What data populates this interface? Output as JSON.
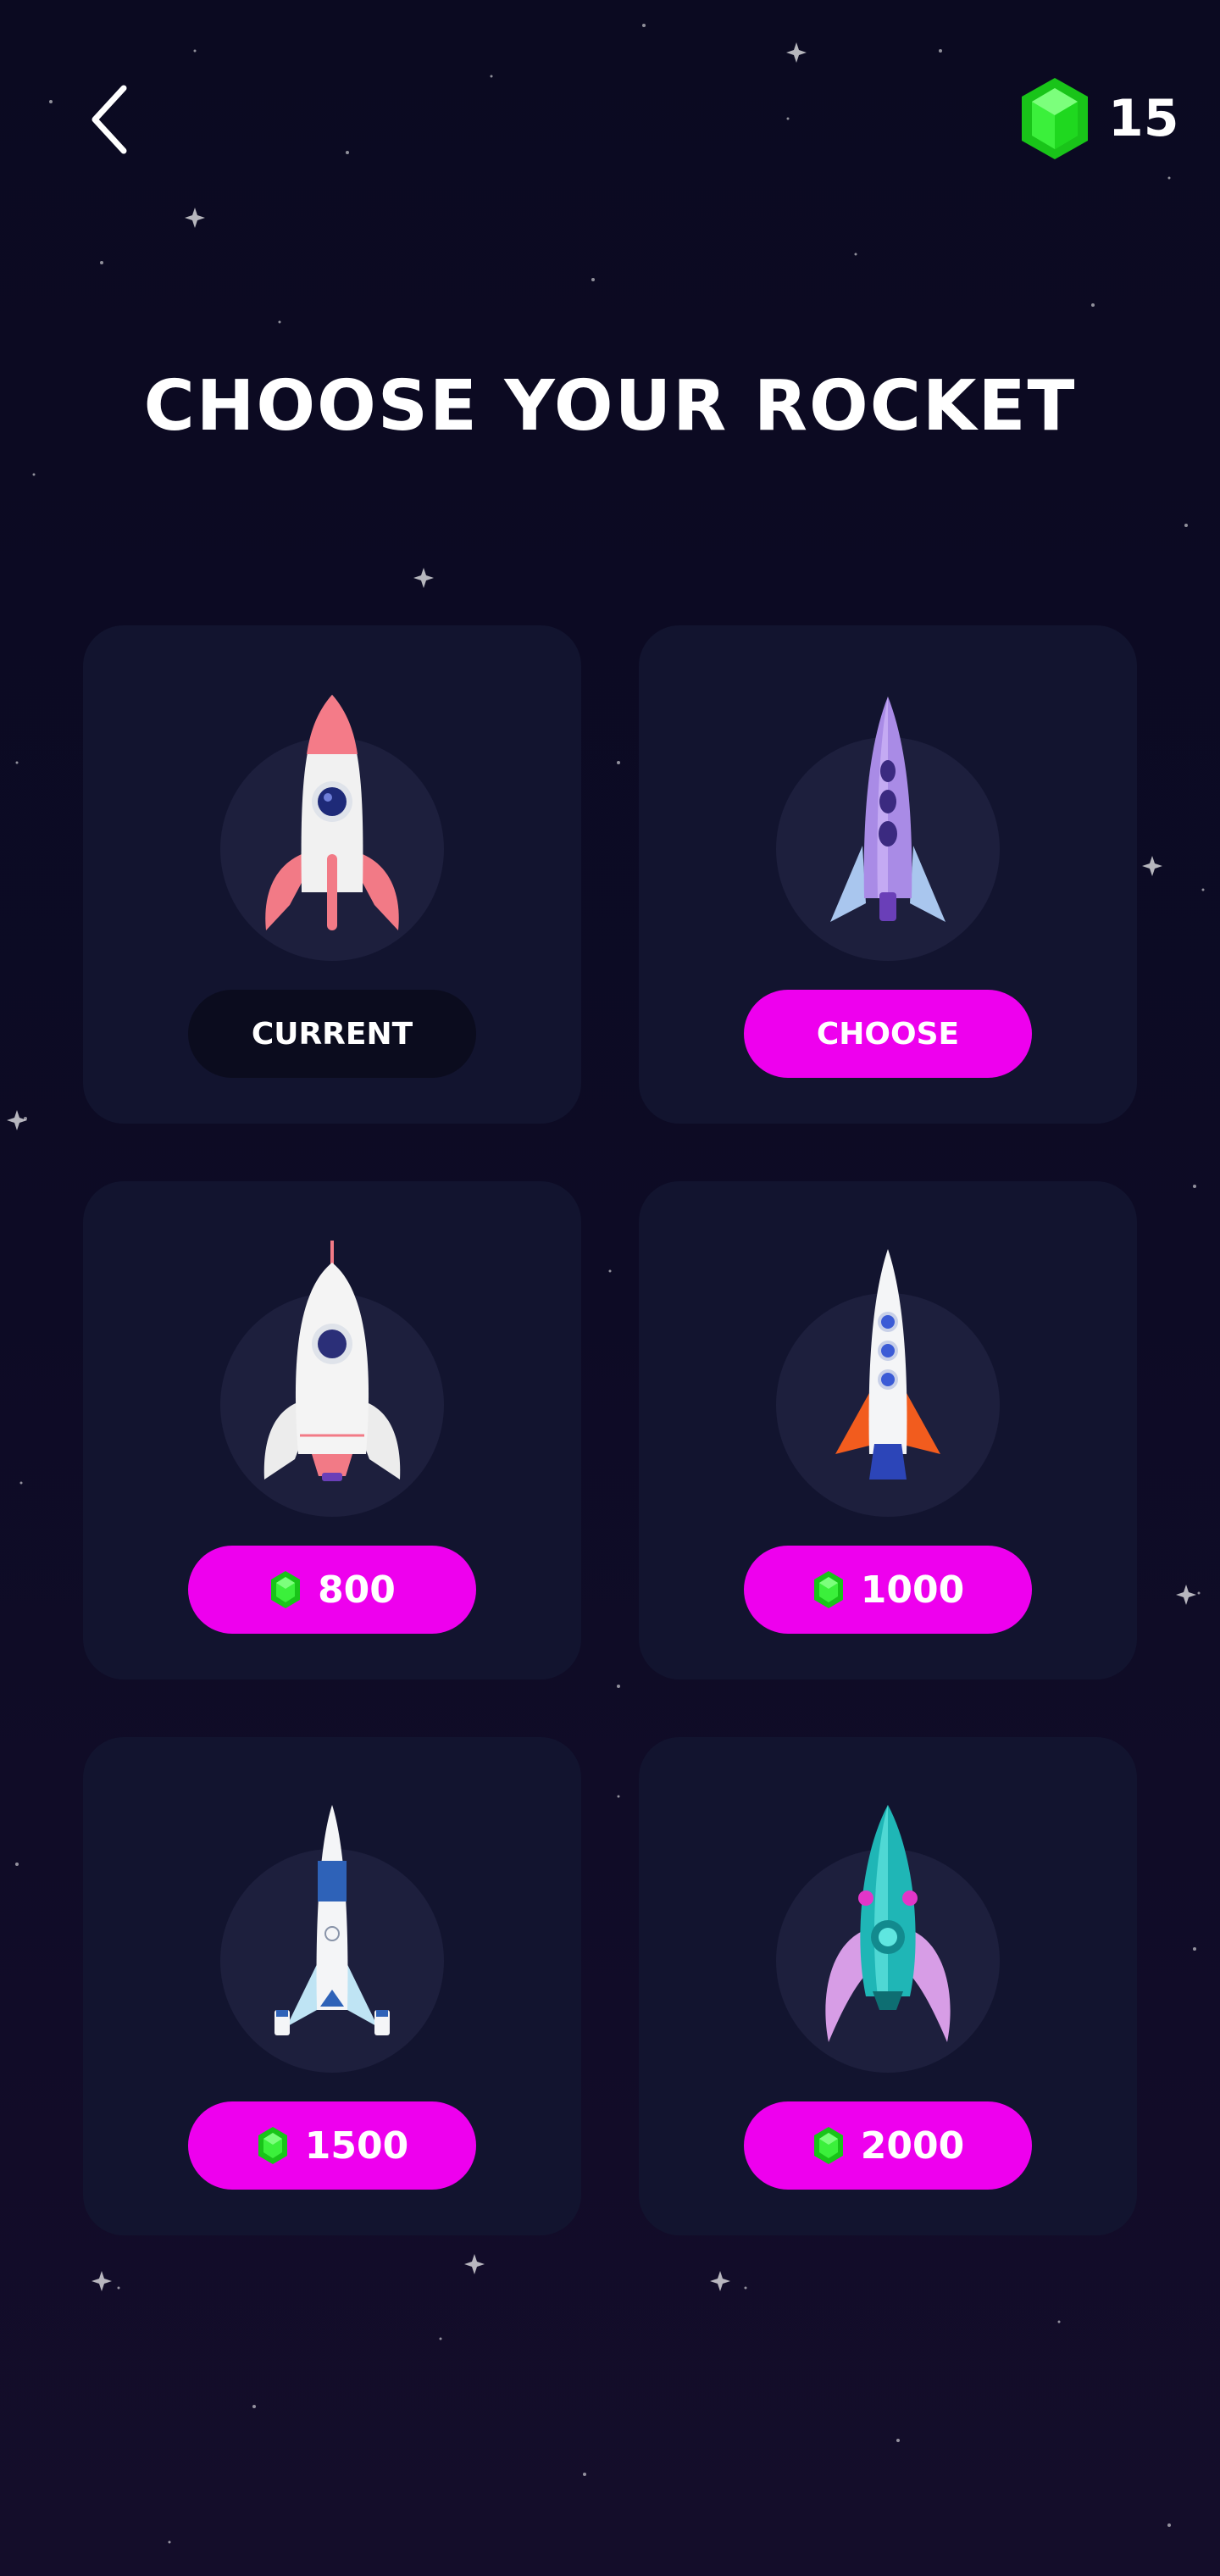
{
  "header": {
    "back_icon": "chevron-left-icon",
    "gem_icon": "gem-icon",
    "gem_count": "15"
  },
  "title": "CHOOSE YOUR ROCKET",
  "colors": {
    "background": "#0b0a21",
    "card": "#12142f",
    "accent": "#ee00ee",
    "gem": "#22dd22"
  },
  "rockets": [
    {
      "button": "CURRENT",
      "state": "current",
      "rocket_icon": "pink-white-rocket-icon"
    },
    {
      "button": "CHOOSE",
      "state": "owned",
      "rocket_icon": "purple-rocket-icon"
    },
    {
      "price": "800",
      "state": "locked",
      "rocket_icon": "white-round-rocket-icon"
    },
    {
      "price": "1000",
      "state": "locked",
      "rocket_icon": "orange-fin-rocket-icon"
    },
    {
      "price": "1500",
      "state": "locked",
      "rocket_icon": "blue-white-rocket-icon"
    },
    {
      "price": "2000",
      "state": "locked",
      "rocket_icon": "teal-alien-rocket-icon"
    }
  ]
}
